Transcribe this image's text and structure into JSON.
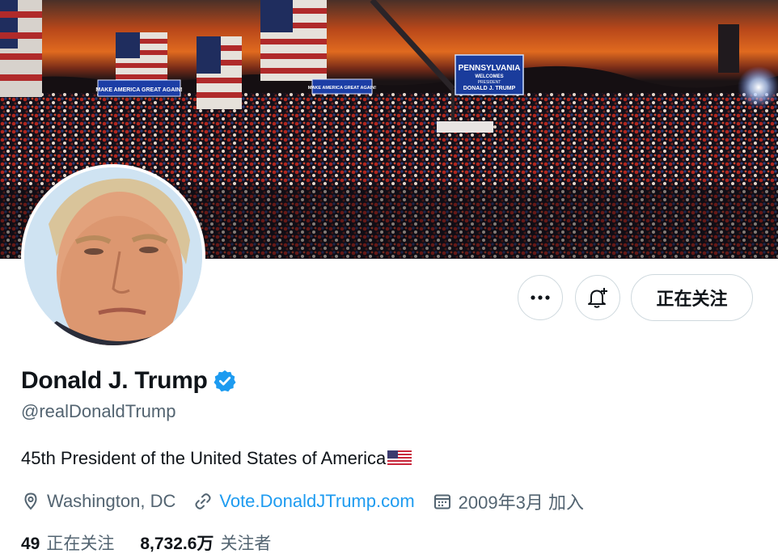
{
  "banner": {
    "sign_large_line1": "PENNSYLVANIA",
    "sign_large_line2": "WELCOMES",
    "sign_large_line3": "PRESIDENT",
    "sign_large_line4": "DONALD J. TRUMP",
    "sign_small_left": "MAKE AMERICA GREAT AGAIN!",
    "sign_small_center": "MAKE AMERICA GREAT AGAIN!"
  },
  "actions": {
    "more_icon": "more-icon",
    "bell_icon": "bell-plus-icon",
    "follow_label": "正在关注"
  },
  "profile": {
    "name": "Donald J. Trump",
    "handle": "@realDonaldTrump",
    "bio": "45th President of the United States of America",
    "location": "Washington, DC",
    "website": "Vote.DonaldJTrump.com",
    "joined": "2009年3月 加入"
  },
  "stats": {
    "following_count": "49",
    "following_label": "正在关注",
    "followers_count": "8,732.6万",
    "followers_label": "关注者"
  },
  "colors": {
    "accent": "#1d9bf0",
    "secondary_text": "#536471",
    "border": "#cfd9de"
  }
}
